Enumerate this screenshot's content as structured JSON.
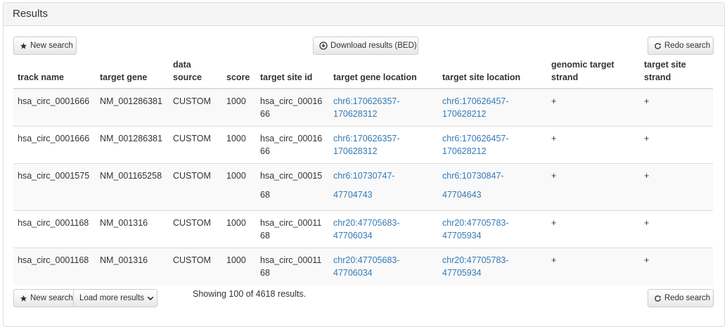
{
  "panel": {
    "title": "Results"
  },
  "toolbar_top": {
    "new_search_label": "New search",
    "download_label": "Download results (BED)",
    "redo_label": "Redo search"
  },
  "table": {
    "columns": [
      "track name",
      "target gene",
      "data source",
      "score",
      "target site id",
      "target gene location",
      "target site location",
      "genomic target strand",
      "target site strand"
    ],
    "rows": [
      {
        "track": "hsa_circ_0001666",
        "gene": "NM_001286381",
        "source": "CUSTOM",
        "score": "1000",
        "site_id": "hsa_circ_0001666",
        "gene_loc": "chr6:170626357-170628312",
        "site_loc": "chr6:170626457-170628212",
        "genomic_strand": "+",
        "site_strand": "+"
      },
      {
        "track": "hsa_circ_0001666",
        "gene": "NM_001286381",
        "source": "CUSTOM",
        "score": "1000",
        "site_id": "hsa_circ_0001666",
        "gene_loc": "chr6:170626357-170628312",
        "site_loc": "chr6:170626457-170628212",
        "genomic_strand": "+",
        "site_strand": "+"
      },
      {
        "track": "hsa_circ_0001575",
        "gene": "NM_001165258",
        "source": "CUSTOM",
        "score": "1000",
        "site_id": "hsa_circ_0001568",
        "gene_loc": "chr6:10730747-47704743",
        "site_loc": "chr6:10730847-47704643",
        "genomic_strand": "+",
        "site_strand": "+"
      },
      {
        "track": "hsa_circ_0001168",
        "gene": "NM_001316",
        "source": "CUSTOM",
        "score": "1000",
        "site_id": "hsa_circ_0001168",
        "gene_loc": "chr20:47705683-47706034",
        "site_loc": "chr20:47705783-47705934",
        "genomic_strand": "+",
        "site_strand": "+"
      },
      {
        "track": "hsa_circ_0001168",
        "gene": "NM_001316",
        "source": "CUSTOM",
        "score": "1000",
        "site_id": "hsa_circ_0001168",
        "gene_loc": "chr20:47705683-47706034",
        "site_loc": "chr20:47705783-47705934",
        "genomic_strand": "+",
        "site_strand": "+"
      }
    ]
  },
  "toolbar_bottom": {
    "new_search_label": "New search",
    "load_more_label": "Load more results",
    "status_text": "Showing 100 of 4618 results.",
    "redo_label": "Redo search"
  },
  "icons": {
    "star": "star-icon",
    "download": "download-circle-icon",
    "redo": "redo-icon",
    "chevron": "chevron-down-icon"
  },
  "colors": {
    "link": "#337ab7",
    "stripe": "#f9f9f9",
    "heading_bg": "#f5f5f5"
  }
}
